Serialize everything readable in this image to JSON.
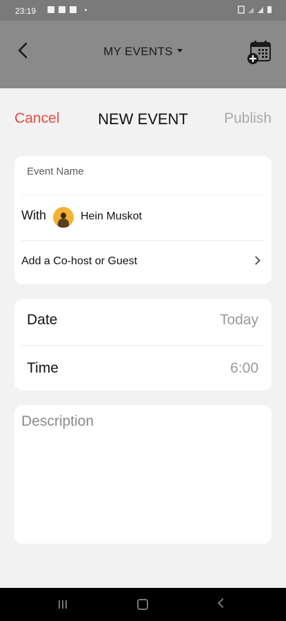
{
  "status_bar": {
    "time": "23:19"
  },
  "header": {
    "title": "MY EVENTS"
  },
  "sheet": {
    "cancel_label": "Cancel",
    "title": "NEW EVENT",
    "publish_label": "Publish",
    "event_name_placeholder": "Event Name",
    "with_label": "With",
    "host_name": "Hein Muskot",
    "add_cohost_label": "Add a Co-host or Guest",
    "date_label": "Date",
    "date_value": "Today",
    "time_label": "Time",
    "time_value": "6:00",
    "description_placeholder": "Description"
  },
  "colors": {
    "accent_red": "#e8493e",
    "publish_disabled": "#a9a9a9",
    "overlay": "#8a8a8a"
  },
  "icons": [
    "back-arrow-icon",
    "caret-down-icon",
    "calendar-add-icon",
    "chevron-right-icon",
    "avatar",
    "recents-icon",
    "home-icon",
    "nav-back-icon"
  ]
}
